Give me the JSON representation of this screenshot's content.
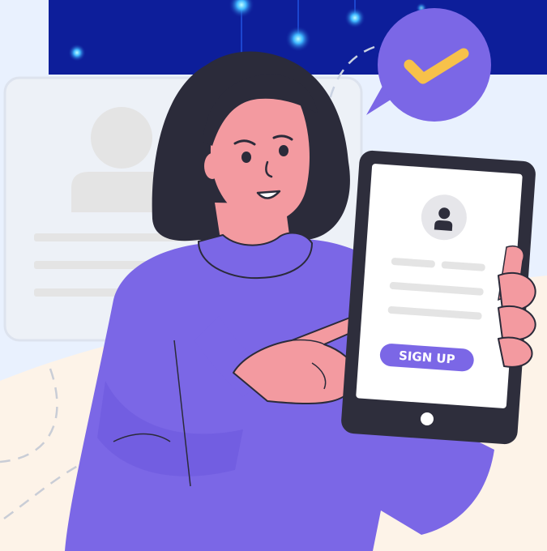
{
  "colors": {
    "background": "#e9f1fe",
    "floor": "#fdf3e8",
    "banner": "#0d1e9a",
    "sweater": "#7b67e6",
    "sweater_shadow": "#5e4ccc",
    "skin": "#f39aa0",
    "hair": "#2b2b3a",
    "device": "#2e2e3c",
    "accent": "#7b67e6",
    "check": "#f7c14a",
    "placeholder": "#e4e4e4"
  },
  "icons": {
    "speech_bubble": "checkmark-speech-bubble-icon",
    "avatar": "user-avatar-icon",
    "home": "home-button-icon"
  },
  "tablet": {
    "signup_label": "SIGN UP"
  }
}
